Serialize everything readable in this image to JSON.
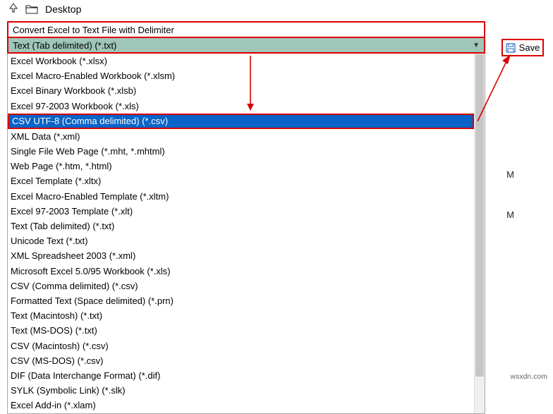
{
  "header": {
    "location": "Desktop"
  },
  "filename": "Convert Excel to Text File with Delimiter",
  "dropdown": {
    "selected": "Text (Tab delimited) (*.txt)"
  },
  "save_button": "Save",
  "time_marks": {
    "m1": "M",
    "m2": "M"
  },
  "watermark": "wsxdn.com",
  "formats": [
    {
      "label": "Excel Workbook (*.xlsx)"
    },
    {
      "label": "Excel Macro-Enabled Workbook (*.xlsm)"
    },
    {
      "label": "Excel Binary Workbook (*.xlsb)"
    },
    {
      "label": "Excel 97-2003 Workbook (*.xls)"
    },
    {
      "label": "CSV UTF-8 (Comma delimited) (*.csv)",
      "highlighted": true
    },
    {
      "label": "XML Data (*.xml)"
    },
    {
      "label": "Single File Web Page (*.mht, *.mhtml)"
    },
    {
      "label": "Web Page (*.htm, *.html)"
    },
    {
      "label": "Excel Template (*.xltx)"
    },
    {
      "label": "Excel Macro-Enabled Template (*.xltm)"
    },
    {
      "label": "Excel 97-2003 Template (*.xlt)"
    },
    {
      "label": "Text (Tab delimited) (*.txt)"
    },
    {
      "label": "Unicode Text (*.txt)"
    },
    {
      "label": "XML Spreadsheet 2003 (*.xml)"
    },
    {
      "label": "Microsoft Excel 5.0/95 Workbook (*.xls)"
    },
    {
      "label": "CSV (Comma delimited) (*.csv)"
    },
    {
      "label": "Formatted Text (Space delimited) (*.prn)"
    },
    {
      "label": "Text (Macintosh) (*.txt)"
    },
    {
      "label": "Text (MS-DOS) (*.txt)"
    },
    {
      "label": "CSV (Macintosh) (*.csv)"
    },
    {
      "label": "CSV (MS-DOS) (*.csv)"
    },
    {
      "label": "DIF (Data Interchange Format) (*.dif)"
    },
    {
      "label": "SYLK (Symbolic Link) (*.slk)"
    },
    {
      "label": "Excel Add-in (*.xlam)"
    }
  ]
}
